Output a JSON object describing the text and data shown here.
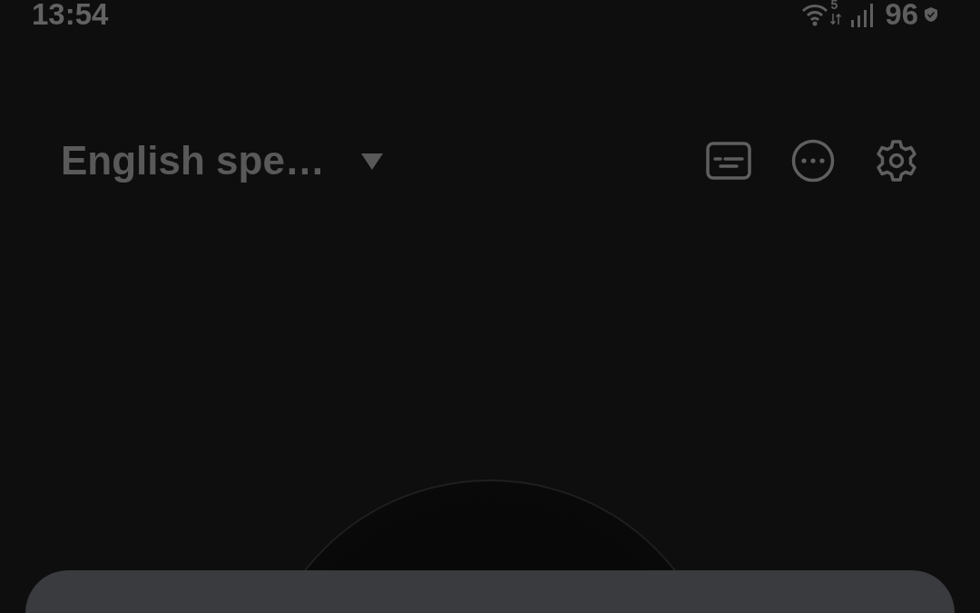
{
  "status_bar": {
    "time": "13:54",
    "network_type": "5",
    "battery": "96"
  },
  "header": {
    "title": "English spe…"
  }
}
